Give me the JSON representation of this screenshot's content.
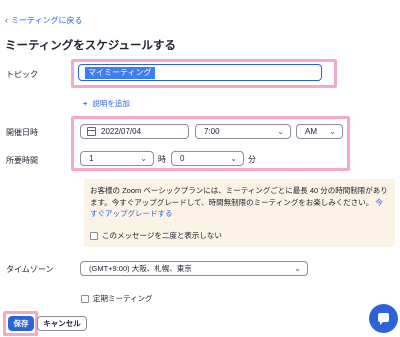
{
  "back_link": {
    "icon": "chevron-left-icon",
    "label": "ミーティングに戻る"
  },
  "page_title": "ミーティングをスケジュールする",
  "topic": {
    "label": "トピック",
    "value": "マイミーティング"
  },
  "add_description": "説明を追加",
  "start": {
    "label": "開催日時",
    "date": "2022/07/04",
    "time": "7:00",
    "ampm": "AM"
  },
  "duration": {
    "label": "所要時間",
    "hours": "1",
    "hours_unit": "時",
    "minutes": "0",
    "minutes_unit": "分"
  },
  "notice": {
    "text": "お客様の Zoom ベーシックプランには、ミーティングごとに最長 40 分の時間制限があります。今すぐアップグレードして、時間無制限のミーティングをお楽しみください。",
    "upgrade_link": "今すぐアップグレードする",
    "dismiss_label": "このメッセージを二度と表示しない"
  },
  "timezone": {
    "label": "タイムゾーン",
    "value": "(GMT+9:00) 大阪、札幌、東京"
  },
  "recurring_label": "定期ミーティング",
  "buttons": {
    "save": "保存",
    "cancel": "キャンセル"
  },
  "colors": {
    "accent": "#2d63d8",
    "highlight": "#f4a9c9",
    "notice_bg": "#fbf3e6"
  }
}
